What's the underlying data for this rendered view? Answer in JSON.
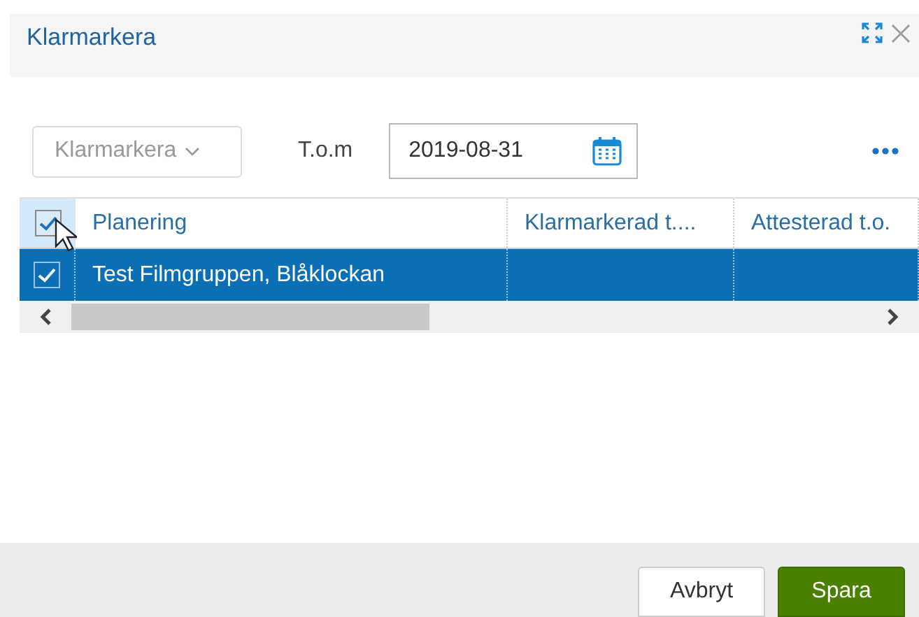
{
  "window": {
    "title": "Klarmarkera"
  },
  "toolbar": {
    "action_select": "Klarmarkera",
    "date_label": "T.o.m",
    "date_value": "2019-08-31"
  },
  "table": {
    "all_checked": true,
    "columns": [
      "Planering",
      "Klarmarkerad t....",
      "Attesterad t.o."
    ],
    "rows": [
      {
        "checked": true,
        "selected": true,
        "cells": [
          "Test Filmgruppen, Blåklockan",
          "",
          ""
        ]
      }
    ]
  },
  "buttons": [
    {
      "label": "Avbryt",
      "kind": "secondary"
    },
    {
      "label": "Spara",
      "kind": "primary"
    }
  ]
}
